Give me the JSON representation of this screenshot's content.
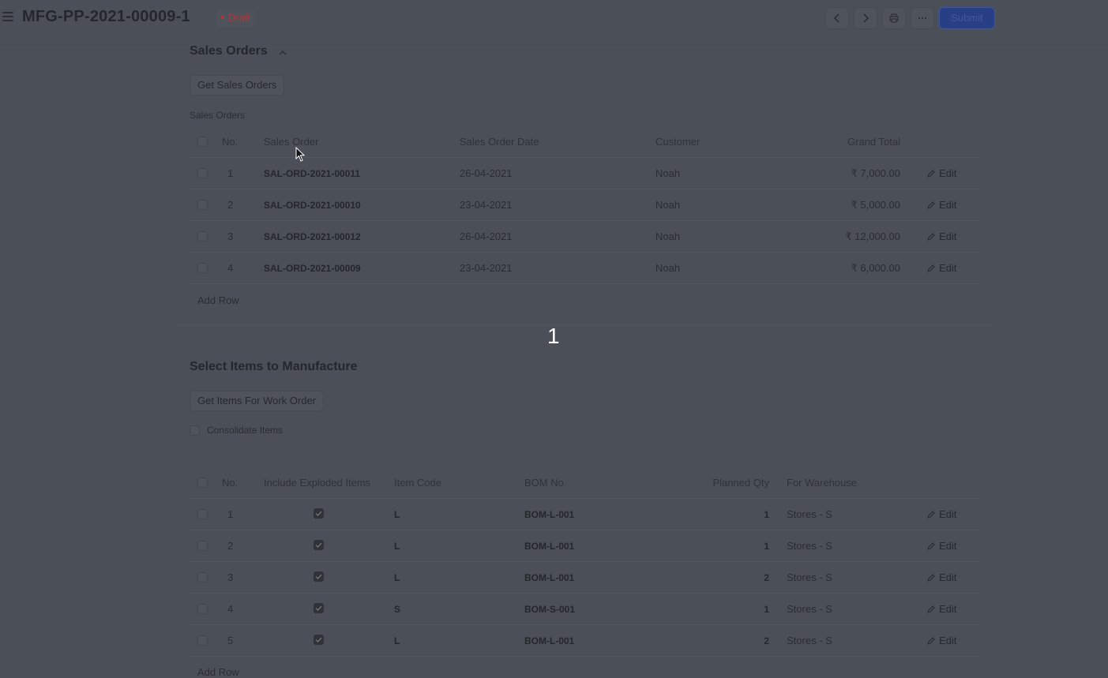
{
  "header": {
    "title": "MFG-PP-2021-00009-1",
    "status": "Draft",
    "submit_label": "Submit"
  },
  "sales_section": {
    "title": "Sales Orders",
    "get_button": "Get Sales Orders",
    "table_label": "Sales Orders",
    "columns": {
      "no": "No.",
      "sales_order": "Sales Order",
      "date": "Sales Order Date",
      "customer": "Customer",
      "grand_total": "Grand Total"
    },
    "rows": [
      {
        "no": "1",
        "order": "SAL-ORD-2021-00011",
        "date": "26-04-2021",
        "customer": "Noah",
        "total": "₹ 7,000.00"
      },
      {
        "no": "2",
        "order": "SAL-ORD-2021-00010",
        "date": "23-04-2021",
        "customer": "Noah",
        "total": "₹ 5,000.00"
      },
      {
        "no": "3",
        "order": "SAL-ORD-2021-00012",
        "date": "26-04-2021",
        "customer": "Noah",
        "total": "₹ 12,000.00"
      },
      {
        "no": "4",
        "order": "SAL-ORD-2021-00009",
        "date": "23-04-2021",
        "customer": "Noah",
        "total": "₹ 6,000.00"
      }
    ],
    "edit_label": "Edit",
    "add_row": "Add Row"
  },
  "overlay_number": "1",
  "items_section": {
    "title": "Select Items to Manufacture",
    "get_button": "Get Items For Work Order",
    "consolidate_label": "Consolidate Items",
    "columns": {
      "no": "No.",
      "include_exploded": "Include Exploded Items",
      "item_code": "Item Code",
      "bom_no": "BOM No",
      "planned_qty": "Planned Qty",
      "warehouse": "For Warehouse"
    },
    "rows": [
      {
        "no": "1",
        "exploded": true,
        "item": "L",
        "bom": "BOM-L-001",
        "qty": "1",
        "warehouse": "Stores - S"
      },
      {
        "no": "2",
        "exploded": true,
        "item": "L",
        "bom": "BOM-L-001",
        "qty": "1",
        "warehouse": "Stores - S"
      },
      {
        "no": "3",
        "exploded": true,
        "item": "L",
        "bom": "BOM-L-001",
        "qty": "2",
        "warehouse": "Stores - S"
      },
      {
        "no": "4",
        "exploded": true,
        "item": "S",
        "bom": "BOM-S-001",
        "qty": "1",
        "warehouse": "Stores - S"
      },
      {
        "no": "5",
        "exploded": true,
        "item": "L",
        "bom": "BOM-L-001",
        "qty": "2",
        "warehouse": "Stores - S"
      }
    ],
    "edit_label": "Edit",
    "add_row": "Add Row"
  }
}
